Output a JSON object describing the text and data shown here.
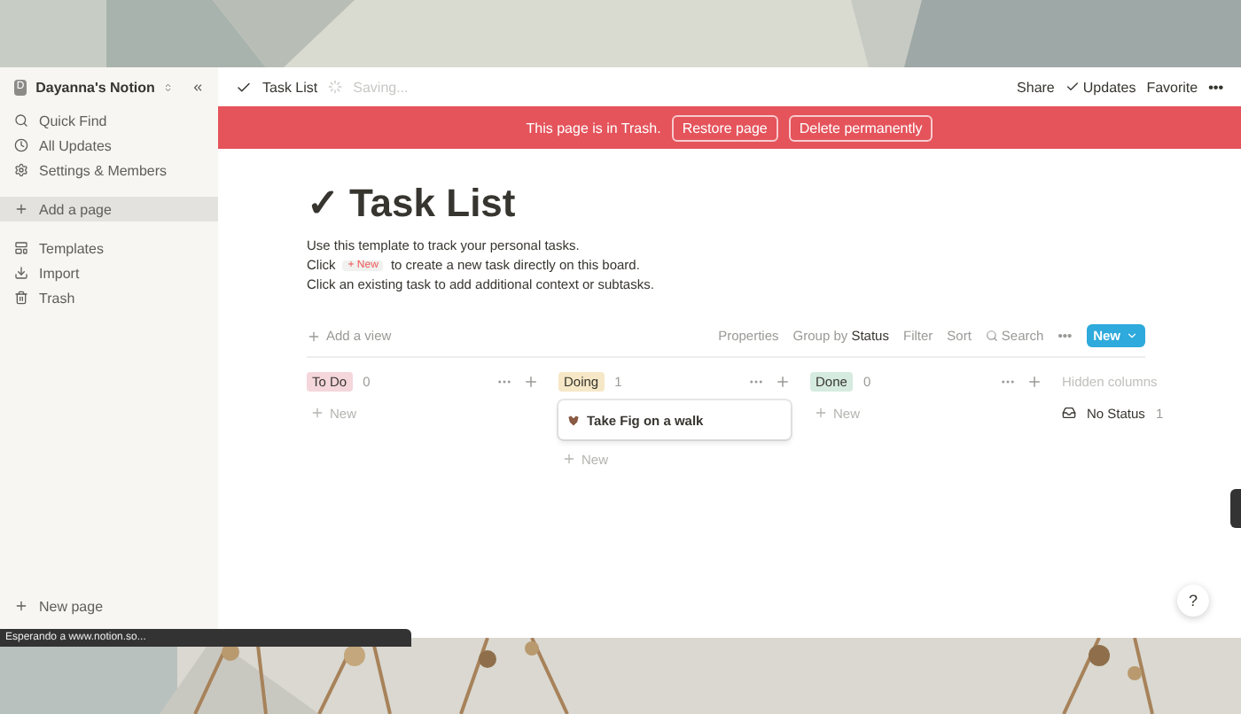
{
  "sidebar": {
    "workspace_initial": "D",
    "workspace": "Dayanna's Notion",
    "items": [
      {
        "kind": "search",
        "label": "Quick Find"
      },
      {
        "kind": "updates",
        "label": "All Updates"
      },
      {
        "kind": "settings",
        "label": "Settings & Members"
      }
    ],
    "add_page": {
      "label": "Add a page",
      "hovered": true
    },
    "tools": [
      {
        "kind": "templates",
        "label": "Templates"
      },
      {
        "kind": "import",
        "label": "Import"
      },
      {
        "kind": "trash",
        "label": "Trash"
      }
    ],
    "new_page": "New page"
  },
  "topbar": {
    "breadcrumb": "Task List",
    "saving": "Saving...",
    "actions": [
      {
        "kind": "text",
        "label": "Share"
      },
      {
        "kind": "check",
        "label": "Updates"
      },
      {
        "kind": "text",
        "label": "Favorite"
      },
      {
        "kind": "more",
        "label": "•••"
      }
    ]
  },
  "banner": {
    "message": "This page is in Trash.",
    "buttons": [
      "Restore page",
      "Delete permanently"
    ]
  },
  "page": {
    "icon": "✓",
    "title": "Task List",
    "lines": [
      "Use this template to track your personal tasks.",
      "Click",
      "to create a new task directly on this board.",
      "Click an existing task to add additional context or subtasks."
    ],
    "chip": "+ New"
  },
  "toolbar": {
    "add_view": "Add a view",
    "properties": "Properties",
    "group_prefix": "Group by",
    "group_value": "Status",
    "filter": "Filter",
    "sort": "Sort",
    "search": "Search",
    "more": "•••",
    "new": "New"
  },
  "columns": [
    {
      "name": "To Do",
      "count": "0",
      "color": "#f4d6db",
      "new": "New"
    },
    {
      "name": "Doing",
      "count": "1",
      "color": "#f6e8c6",
      "cards": [
        "Take Fig on a walk"
      ],
      "new": "New"
    },
    {
      "name": "Done",
      "count": "0",
      "color": "#d6ebe0",
      "new": "New"
    }
  ],
  "hidden": {
    "heading": "Hidden columns",
    "items": [
      {
        "name": "No Status",
        "count": "1"
      }
    ]
  },
  "help": "?",
  "status_bar": "Esperando a www.notion.so..."
}
